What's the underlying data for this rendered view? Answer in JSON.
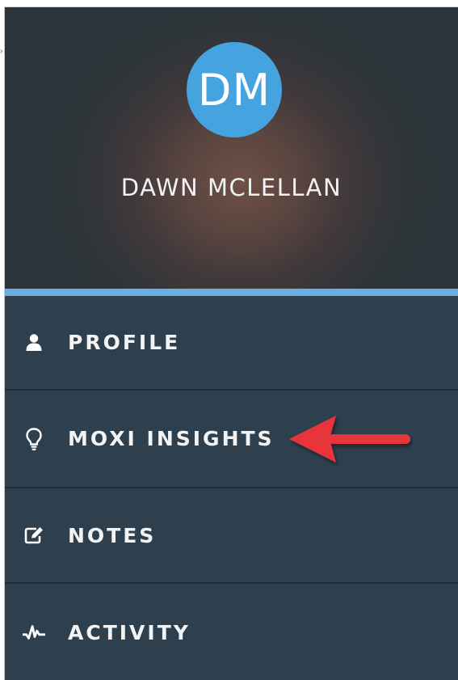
{
  "profile_header": {
    "avatar_initials": "DM",
    "user_name": "DAWN MCLELLAN"
  },
  "menu": {
    "items": [
      {
        "label": "PROFILE",
        "icon": "user-icon"
      },
      {
        "label": "MOXI INSIGHTS",
        "icon": "lightbulb-icon"
      },
      {
        "label": "NOTES",
        "icon": "edit-icon"
      },
      {
        "label": "ACTIVITY",
        "icon": "activity-icon"
      }
    ]
  },
  "annotation": {
    "icon": "red-arrow-icon",
    "color": "#e8353b"
  },
  "colors": {
    "avatar": "#45a3df",
    "accent": "#6aaee0",
    "menu_background": "#2e3f4d"
  }
}
